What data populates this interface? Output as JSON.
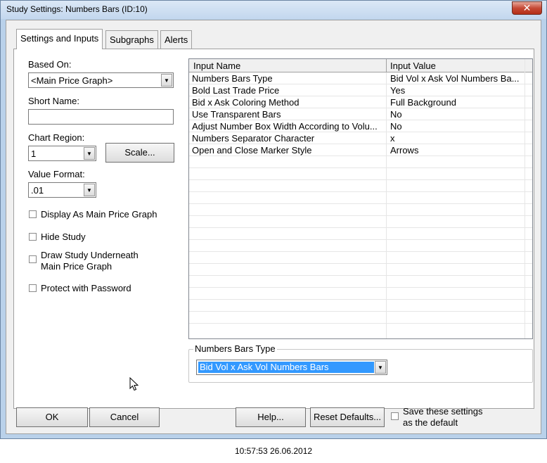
{
  "window": {
    "title": "Study Settings: Numbers Bars (ID:10)",
    "close_label": "✕"
  },
  "tabs": [
    {
      "label": "Settings and Inputs"
    },
    {
      "label": "Subgraphs"
    },
    {
      "label": "Alerts"
    }
  ],
  "left": {
    "based_on_label": "Based On:",
    "based_on_value": "<Main Price Graph>",
    "short_name_label": "Short Name:",
    "short_name_value": "",
    "chart_region_label": "Chart Region:",
    "chart_region_value": "1",
    "scale_button": "Scale...",
    "value_format_label": "Value Format:",
    "value_format_value": ".01",
    "checkboxes": [
      {
        "label": "Display As Main Price Graph",
        "checked": false
      },
      {
        "label": "Hide Study",
        "checked": false
      },
      {
        "label_line1": "Draw Study Underneath",
        "label_line2": "Main Price Graph",
        "checked": false
      },
      {
        "label": "Protect with Password",
        "checked": false
      }
    ]
  },
  "grid": {
    "headers": [
      "Input Name",
      "Input Value"
    ],
    "rows": [
      {
        "name": "Numbers Bars Type",
        "value": "Bid Vol x Ask Vol Numbers Ba..."
      },
      {
        "name": "Bold Last Trade Price",
        "value": "Yes"
      },
      {
        "name": "Bid x Ask Coloring Method",
        "value": "Full Background"
      },
      {
        "name": "Use Transparent Bars",
        "value": "No"
      },
      {
        "name": "Adjust Number Box Width According to Volu...",
        "value": "No"
      },
      {
        "name": "Numbers Separator Character",
        "value": "x"
      },
      {
        "name": "Open and Close Marker Style",
        "value": "Arrows"
      }
    ]
  },
  "editor": {
    "group_label": "Numbers Bars Type",
    "selected_value": "Bid Vol x Ask Vol Numbers Bars"
  },
  "footer": {
    "ok": "OK",
    "cancel": "Cancel",
    "help": "Help...",
    "reset": "Reset Defaults...",
    "save_line1": "Save these settings",
    "save_line2": "as the default"
  },
  "timestamp": "10:57:53 26.06.2012"
}
